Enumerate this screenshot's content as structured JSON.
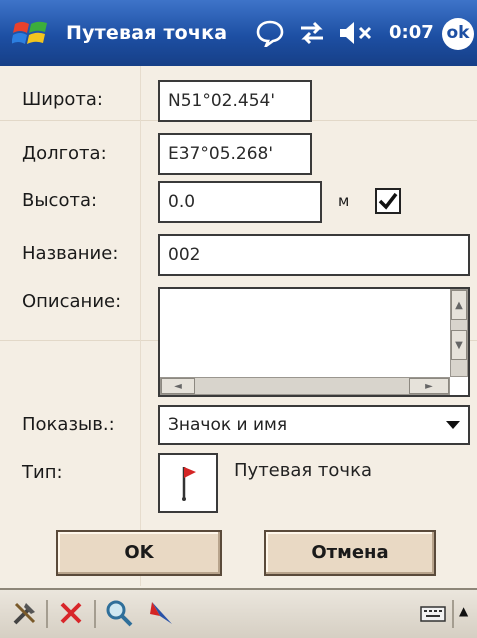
{
  "title_bar": {
    "title": "Путевая точка",
    "clock": "0:07",
    "ok_label": "ok",
    "icons": [
      "windows-start-icon",
      "message-icon",
      "connectivity-icon",
      "speaker-muted-icon"
    ]
  },
  "form": {
    "latitude": {
      "label": "Широта:",
      "value": "N51°02.454'"
    },
    "longitude": {
      "label": "Долгота:",
      "value": "E37°05.268'"
    },
    "altitude": {
      "label": "Высота:",
      "value": "0.0",
      "unit": "м",
      "checked": true
    },
    "name": {
      "label": "Название:",
      "value": "002"
    },
    "description": {
      "label": "Описание:",
      "value": ""
    },
    "show": {
      "label": "Показыв.:",
      "selected": "Значок и имя"
    },
    "type": {
      "label": "Тип:",
      "value": "Путевая точка",
      "icon": "waypoint-flag-icon"
    }
  },
  "buttons": {
    "ok": "OK",
    "cancel": "Отмена"
  },
  "toolbar": {
    "icons": [
      "tools-icon",
      "delete-icon",
      "search-icon",
      "navigate-icon",
      "keyboard-icon"
    ]
  },
  "colors": {
    "title_bar": "#1d4fa3",
    "background": "#f4eee4",
    "button_face": "#e9d9c4"
  }
}
